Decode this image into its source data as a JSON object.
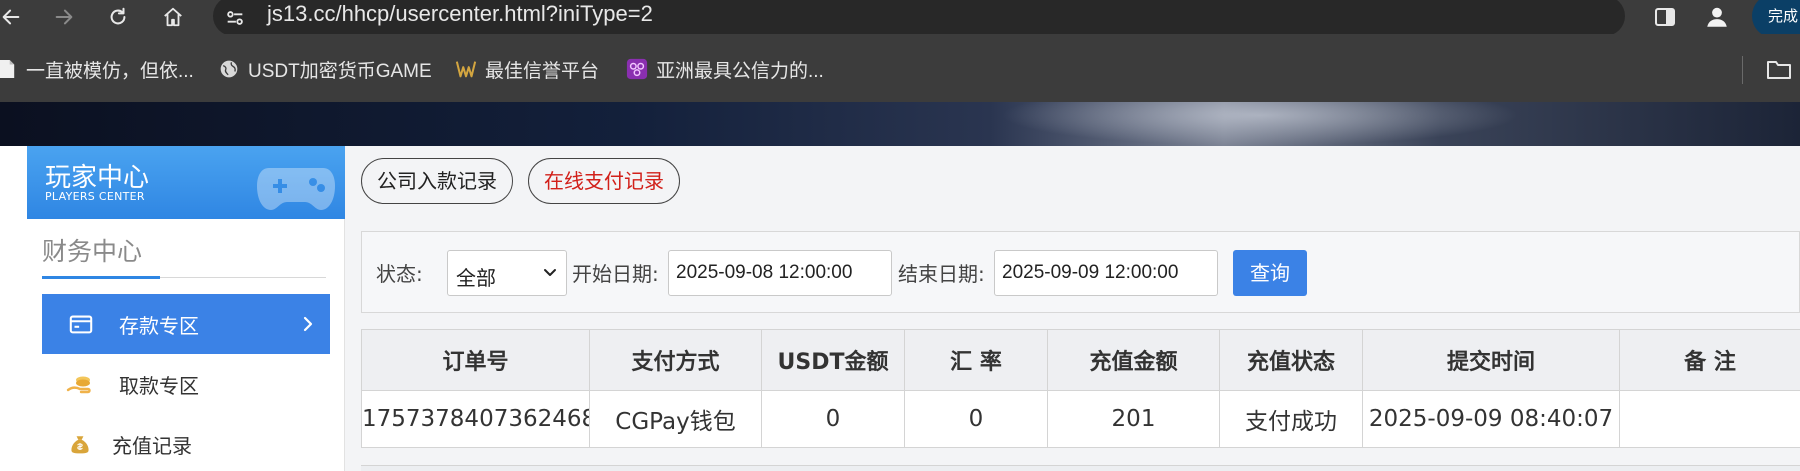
{
  "browser": {
    "url": "js13.cc/hhcp/usercenter.html?iniType=2",
    "finish_button_label": "完成"
  },
  "bookmarks": [
    {
      "label": "一直被模仿，但依...",
      "icon": "page-icon"
    },
    {
      "label": "USDT加密货币GAME",
      "icon": "globe-icon"
    },
    {
      "label": "最佳信誉平台",
      "icon": "favicon-logo"
    },
    {
      "label": "亚洲最具公信力的...",
      "icon": "favicon-purple"
    }
  ],
  "sidebar": {
    "header_title": "玩家中心",
    "header_subtitle": "PLAYERS CENTER",
    "section_title": "财务中心",
    "items": [
      {
        "label": "存款专区",
        "active": true,
        "icon": "card-icon"
      },
      {
        "label": "取款专区",
        "active": false,
        "icon": "hand-coin-icon"
      },
      {
        "label": "充值记录",
        "active": false,
        "icon": "money-bag-icon"
      }
    ]
  },
  "tabs": [
    {
      "label": "公司入款记录",
      "active": false
    },
    {
      "label": "在线支付记录",
      "active": true
    }
  ],
  "filter": {
    "status_label": "状态:",
    "status_value": "全部",
    "start_label": "开始日期:",
    "start_value": "2025-09-08 12:00:00",
    "end_label": "结束日期:",
    "end_value": "2025-09-09 12:00:00",
    "query_label": "查询"
  },
  "table": {
    "columns": [
      "订单号",
      "支付方式",
      "USDT金额",
      "汇 率",
      "充值金额",
      "充值状态",
      "提交时间",
      "备 注"
    ],
    "rows": [
      [
        "1757378407362468",
        "CGPay钱包",
        "0",
        "0",
        "201",
        "支付成功",
        "2025-09-09 08:40:07",
        ""
      ]
    ]
  },
  "colors": {
    "accent": "#3b82e6",
    "active_tab_text": "#d2201a",
    "chrome_bg": "#3c3c3c"
  }
}
